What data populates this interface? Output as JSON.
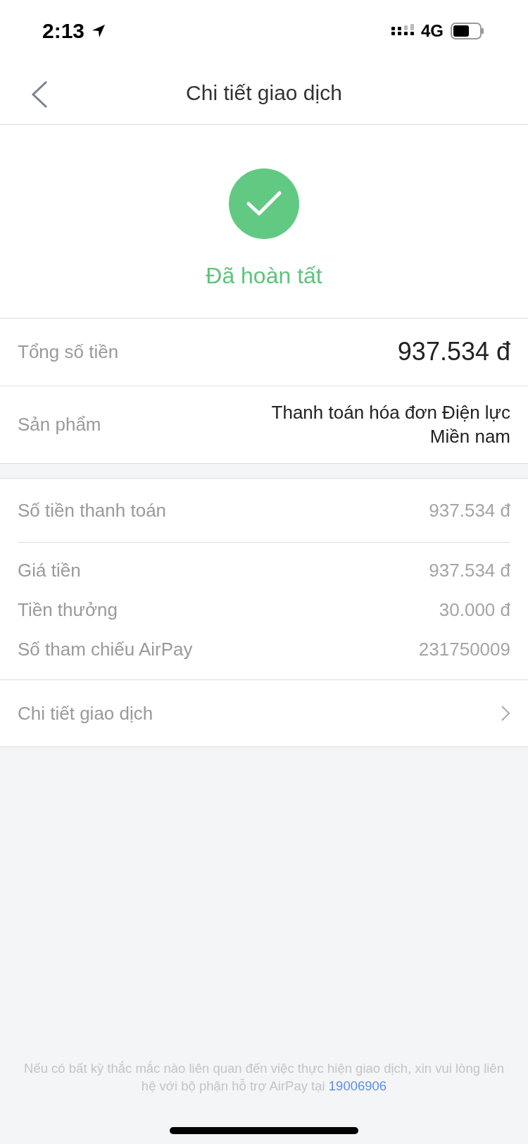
{
  "status_bar": {
    "time": "2:13",
    "network": "4G"
  },
  "nav": {
    "title": "Chi tiết giao dịch"
  },
  "status": {
    "kind": "success",
    "label": "Đã hoàn tất"
  },
  "summary": [
    {
      "label": "Tổng số tiền",
      "value": "937.534 đ",
      "emphasis": true
    },
    {
      "label": "Sản phẩm",
      "value": "Thanh toán hóa đơn Điện lực Miền nam",
      "emphasis": false
    }
  ],
  "payment": {
    "label": "Số tiền thanh toán",
    "value": "937.534 đ"
  },
  "details": [
    {
      "label": "Giá tiền",
      "value": "937.534 đ"
    },
    {
      "label": "Tiền thưởng",
      "value": "30.000 đ"
    },
    {
      "label": "Số tham chiếu AirPay",
      "value": "231750009"
    }
  ],
  "detail_link": {
    "label": "Chi tiết giao dịch"
  },
  "footer": {
    "text": "Nếu có bất kỳ thắc mắc nào liên quan đến việc thực hiện giao dịch, xin vui lòng liên hệ với bộ phận hỗ trợ AirPay tại",
    "phone": "19006906"
  }
}
